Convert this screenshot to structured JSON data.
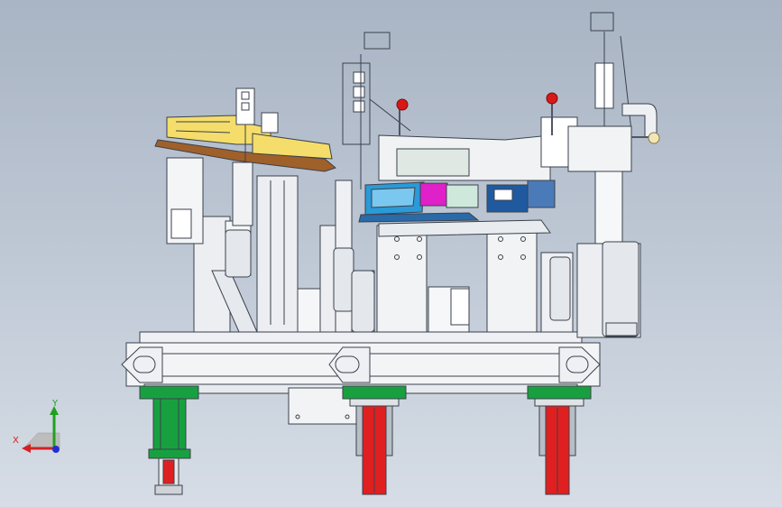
{
  "viewport": {
    "background_top": "#a9b4c4",
    "background_bottom": "#d6dde6"
  },
  "triad": {
    "x_label": "X",
    "y_label": "Y",
    "x_color": "#d42020",
    "y_color": "#20a020",
    "z_color": "#2030d0"
  },
  "model_colors": {
    "frame": "#eef0f3",
    "frame_edge": "#444a55",
    "red_parts": "#e02020",
    "green_parts": "#18a040",
    "blue_part": "#2a9ad8",
    "magenta_part": "#e020c8",
    "yellow_part": "#f4dd6a",
    "brown_part": "#a0602a",
    "knob_red": "#d81818",
    "knob_cream": "#f2e6b8"
  }
}
